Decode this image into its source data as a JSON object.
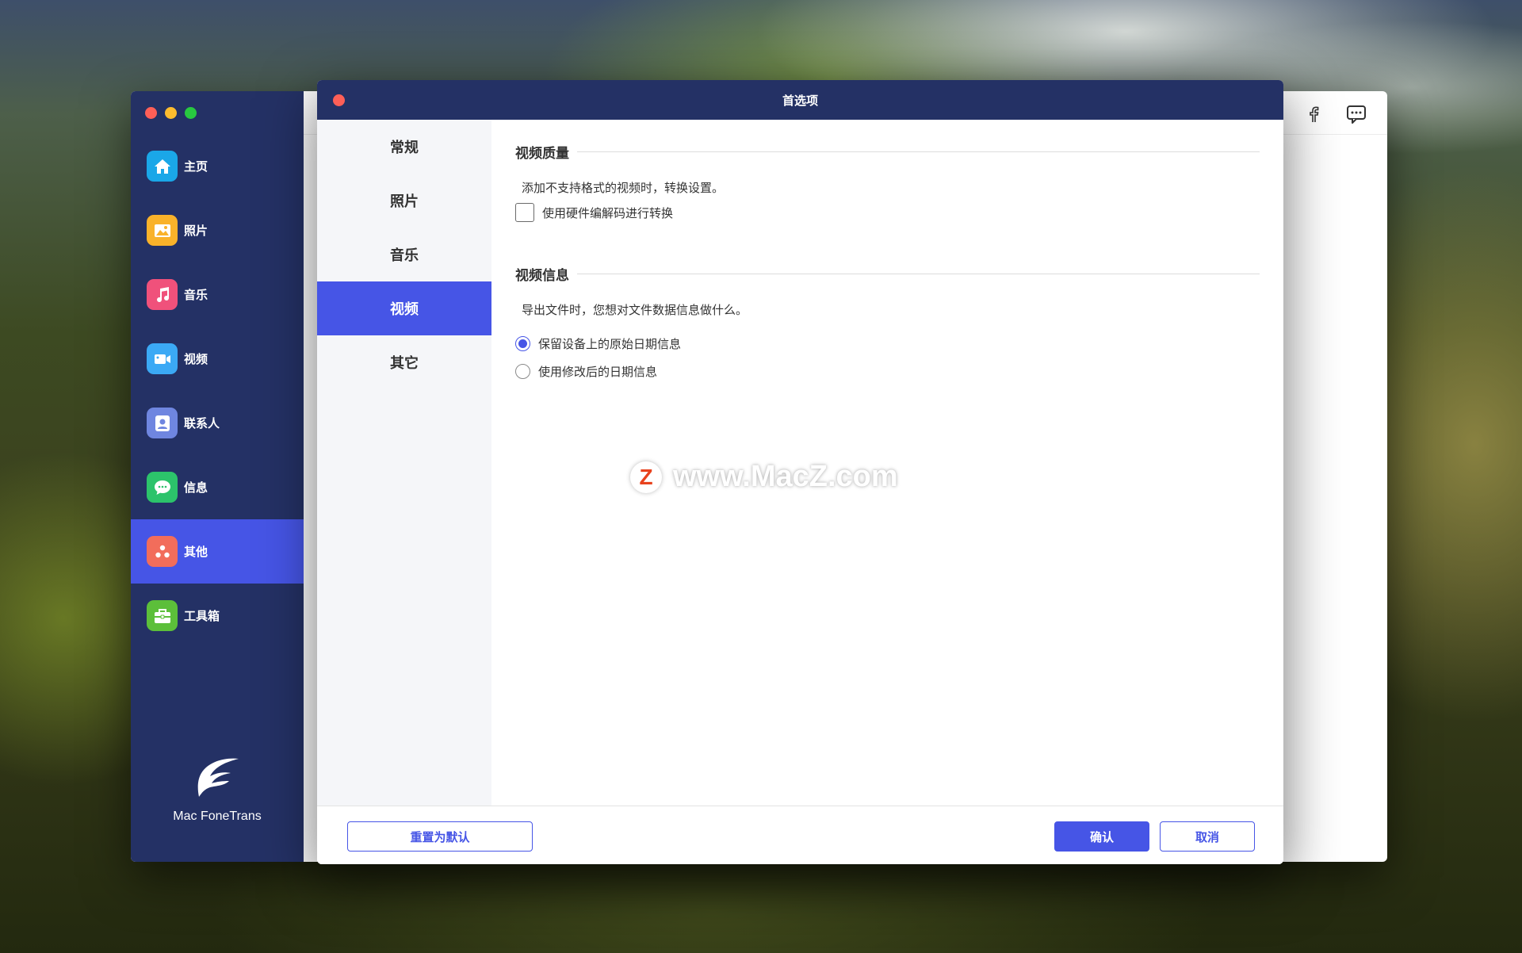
{
  "app": {
    "brand_name": "Mac FoneTrans",
    "nav": [
      {
        "label": "主页",
        "icon": "home-icon",
        "color": "#1aa7e8",
        "active": false
      },
      {
        "label": "照片",
        "icon": "photo-icon",
        "color": "#f9b22a",
        "active": false
      },
      {
        "label": "音乐",
        "icon": "music-icon",
        "color": "#f0517b",
        "active": false
      },
      {
        "label": "视频",
        "icon": "video-icon",
        "color": "#3ba9f5",
        "active": false
      },
      {
        "label": "联系人",
        "icon": "contacts-icon",
        "color": "#6f86e0",
        "active": false
      },
      {
        "label": "信息",
        "icon": "message-icon",
        "color": "#2cc36b",
        "active": false
      },
      {
        "label": "其他",
        "icon": "other-icon",
        "color": "#f26d5b",
        "active": true
      },
      {
        "label": "工具箱",
        "icon": "toolbox-icon",
        "color": "#5cbf3a",
        "active": false
      }
    ],
    "toolbar_icons": [
      "facebook-icon",
      "chat-icon"
    ]
  },
  "dialog": {
    "title": "首选项",
    "nav": [
      {
        "label": "常规",
        "active": false
      },
      {
        "label": "照片",
        "active": false
      },
      {
        "label": "音乐",
        "active": false
      },
      {
        "label": "视频",
        "active": true
      },
      {
        "label": "其它",
        "active": false
      }
    ],
    "video_quality": {
      "title": "视频质量",
      "description": "添加不支持格式的视频时，转换设置。",
      "checkbox_label": "使用硬件编解码进行转换",
      "checked": false
    },
    "video_info": {
      "title": "视频信息",
      "description": "导出文件时，您想对文件数据信息做什么。",
      "options": [
        {
          "label": "保留设备上的原始日期信息",
          "checked": true
        },
        {
          "label": "使用修改后的日期信息",
          "checked": false
        }
      ]
    },
    "buttons": {
      "reset": "重置为默认",
      "confirm": "确认",
      "cancel": "取消"
    }
  },
  "watermark": {
    "logo_letter": "Z",
    "text": "www.MacZ.com"
  },
  "colors": {
    "sidebar": "#243165",
    "accent": "#4655e6"
  }
}
